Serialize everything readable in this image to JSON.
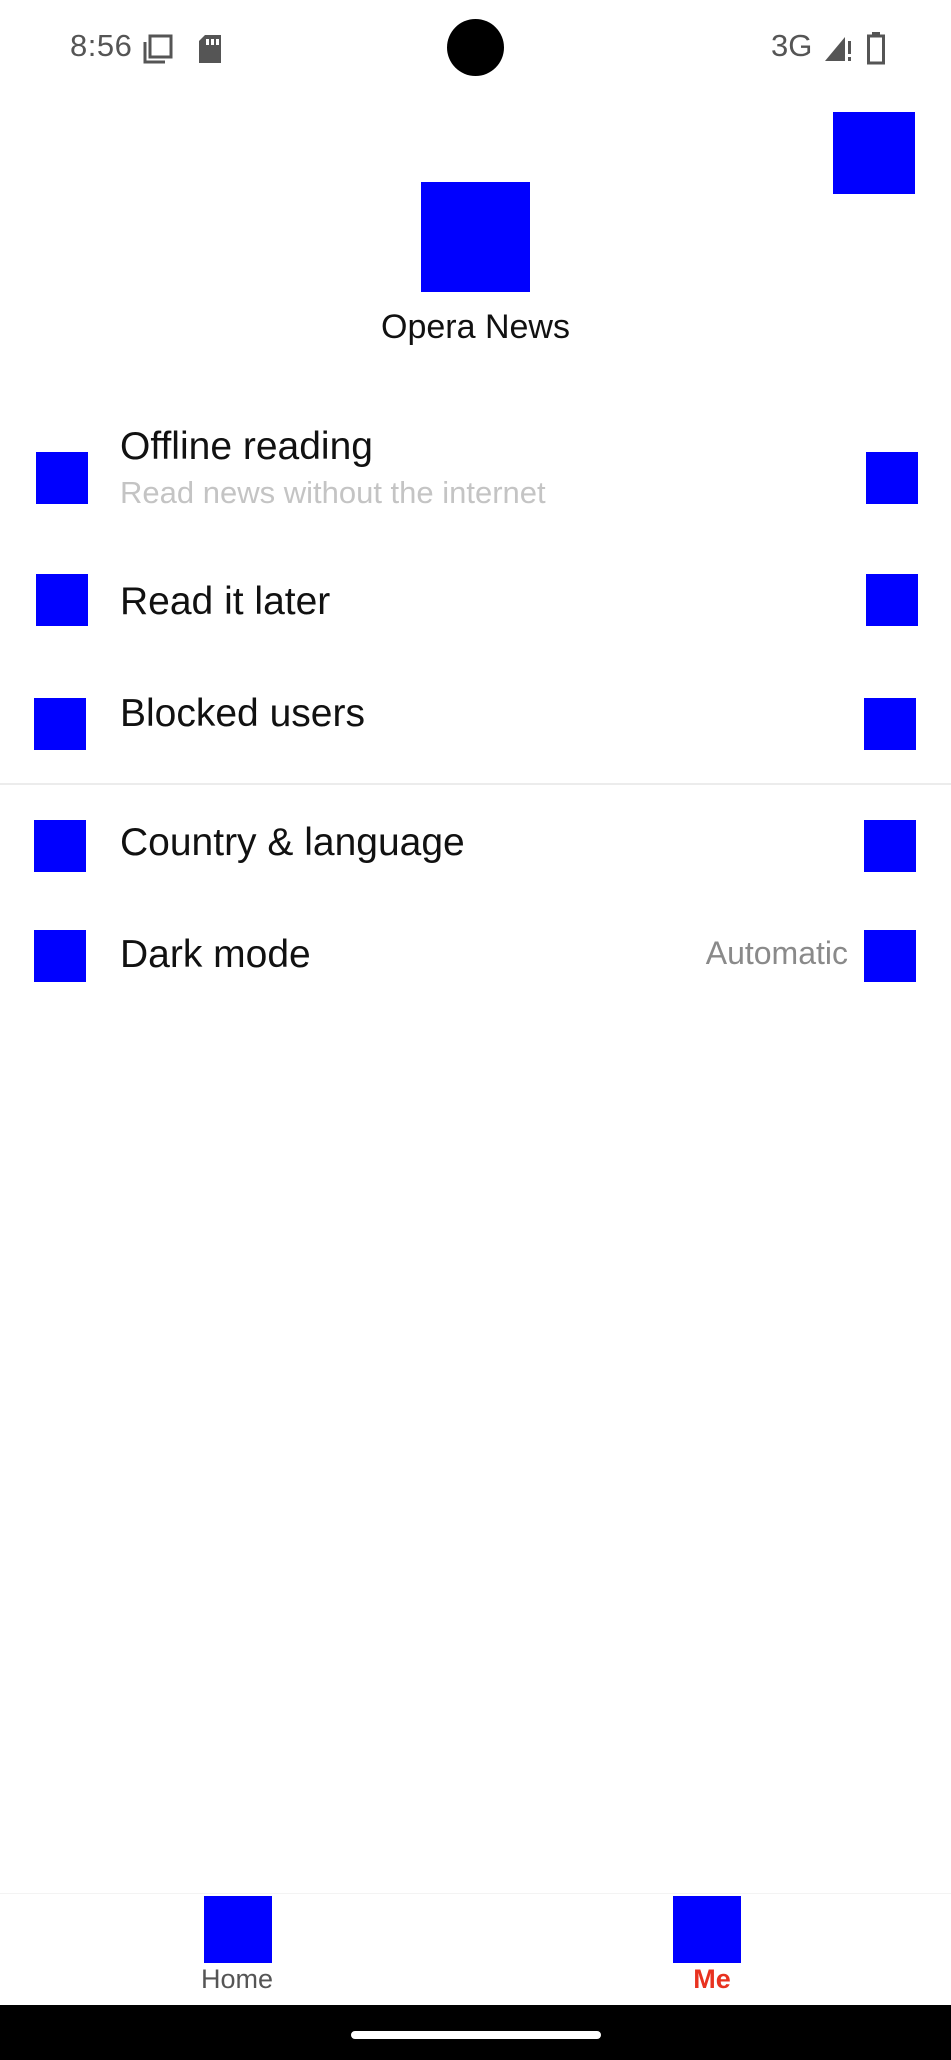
{
  "status_bar": {
    "time": "8:56",
    "network": "3G",
    "icons": [
      "screenshot-icon",
      "sd-card-icon",
      "signal-icon",
      "battery-icon"
    ]
  },
  "header": {
    "app_name": "Opera News",
    "logo_icon": "opera-news-logo",
    "action_icon": "gift-icon"
  },
  "menu": {
    "items": [
      {
        "title": "Offline reading",
        "subtitle": "Read news without the internet",
        "icon": "offline-icon"
      },
      {
        "title": "Read it later",
        "icon": "bookmark-icon"
      },
      {
        "title": "Blocked users",
        "icon": "block-user-icon"
      },
      {
        "title": "Country & language",
        "icon": "globe-icon"
      },
      {
        "title": "Dark mode",
        "value": "Automatic",
        "icon": "moon-icon"
      }
    ]
  },
  "bottom_nav": {
    "tabs": [
      {
        "label": "Home",
        "icon": "home-icon",
        "active": false
      },
      {
        "label": "Me",
        "icon": "profile-icon",
        "active": true
      }
    ]
  },
  "colors": {
    "placeholder_icon": "#0000ff",
    "active_tab": "#e8321f",
    "inactive_tab": "#555555",
    "subtitle": "#c4c4c4",
    "value_text": "#8a8a8a"
  }
}
